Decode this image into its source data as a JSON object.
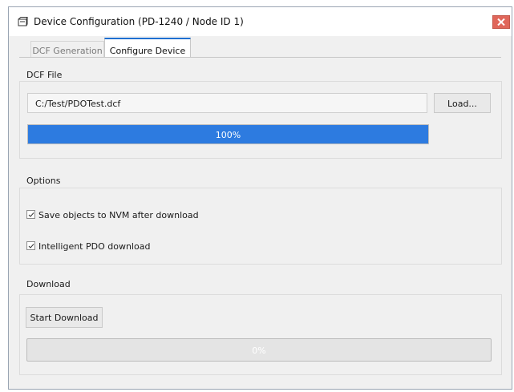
{
  "window": {
    "title": "Device Configuration (PD-1240 / Node ID 1)",
    "icon": "device-icon",
    "close_icon": "close-icon"
  },
  "tabs": [
    {
      "label": "DCF Generation",
      "active": false
    },
    {
      "label": "Configure Device",
      "active": true
    }
  ],
  "dcf_file": {
    "section_label": "DCF File",
    "path_value": "C:/Test/PDOTest.dcf",
    "load_label": "Load...",
    "progress_percent": 100,
    "progress_text": "100%"
  },
  "options": {
    "section_label": "Options",
    "checkboxes": [
      {
        "label": "Save objects to NVM after download",
        "checked": true
      },
      {
        "label": "Intelligent PDO download",
        "checked": true
      }
    ]
  },
  "download": {
    "section_label": "Download",
    "start_label": "Start Download",
    "progress_percent": 0,
    "progress_text": "0%"
  },
  "colors": {
    "accent": "#2d7be0",
    "close_button": "#e0665a",
    "active_tab_border": "#1e6fd1"
  }
}
